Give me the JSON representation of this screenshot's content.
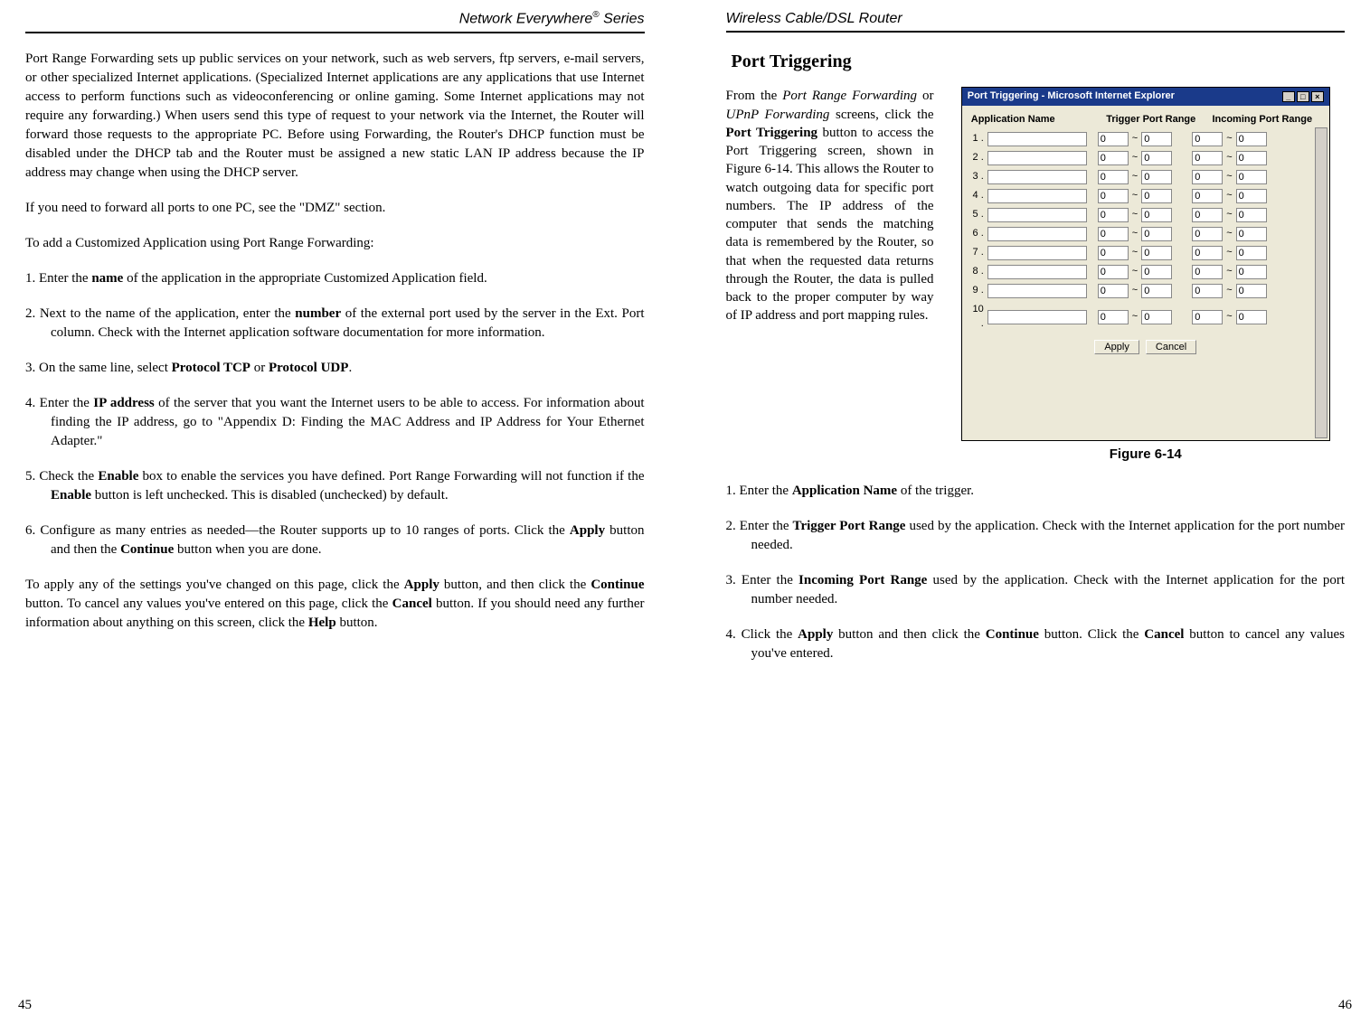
{
  "left": {
    "header": "Network Everywhere® Series",
    "pagenum": "45",
    "p1": "Port Range Forwarding sets up public services on your network, such as web servers, ftp servers, e-mail servers, or other specialized Internet applications. (Specialized Internet applications are any applications that use Internet access to perform functions such as videoconferencing or online gaming. Some Internet applications may not require any forwarding.) When users send this type of request to your network via the Internet, the Router will forward those requests to the appropriate PC.  Before using Forwarding, the Router's DHCP function must be disabled under the DHCP tab and the Router must be assigned a new static LAN IP address because the IP address may change when using the DHCP server.",
    "p2": "If you need to forward all ports to one PC, see the \"DMZ\" section.",
    "p3": "To add a Customized Application using Port Range Forwarding:",
    "s1a": "1.   Enter the ",
    "s1b": "name",
    "s1c": " of the application in the appropriate Customized Application field.",
    "s2a": "2.   Next to the name of the application, enter the ",
    "s2b": "number",
    "s2c": " of the external port used by the server in the Ext. Port column. Check with the Internet application software documentation for more information.",
    "s3a": "3.   On the same line, select ",
    "s3b": "Protocol TCP",
    "s3c": " or ",
    "s3d": "Protocol UDP",
    "s3e": ".",
    "s4a": "4.   Enter the ",
    "s4b": "IP address",
    "s4c": " of the server that you want the Internet users to be able to access. For information about finding the IP address, go to \"Appendix D: Finding the MAC Address and IP Address for Your Ethernet Adapter.\"",
    "s5a": "5.   Check the ",
    "s5b": "Enable",
    "s5c": " box to enable the services you have defined. Port Range Forwarding will not function if the ",
    "s5d": "Enable",
    "s5e": " button is left unchecked. This is disabled (unchecked) by default.",
    "s6a": "6.   Configure as many entries as needed—the Router supports up to 10 ranges of ports. Click the ",
    "s6b": "Apply",
    "s6c": " button and then the ",
    "s6d": "Continue",
    "s6e": " button when you are done.",
    "p4a": "To apply any of the settings you've changed on this page, click the ",
    "p4b": "Apply",
    "p4c": " button, and then click the ",
    "p4d": "Continue",
    "p4e": " button.  To cancel any values you've entered on this page, click the ",
    "p4f": "Cancel",
    "p4g": " button. If you should need any further information about anything on this screen, click the ",
    "p4h": "Help",
    "p4i": " button."
  },
  "right": {
    "header": "Wireless Cable/DSL Router",
    "pagenum": "46",
    "section": "Port Triggering",
    "intro_a": "From the ",
    "intro_b": "Port Range Forwarding",
    "intro_c": " or ",
    "intro_d": "UPnP Forwarding",
    "intro_e": " screens, click the ",
    "intro_f": "Port Triggering",
    "intro_g": " button to access the Port Triggering screen, shown in Figure 6-14. This allows the Router to watch outgoing data for specific port numbers.  The IP address of the computer that sends the matching data is remembered by the Router, so that when the requested data returns through the Router, the data is pulled back to the proper computer by way of IP address and port mapping rules.",
    "figcap": "Figure 6-14",
    "r1a": "1.   Enter the ",
    "r1b": "Application Name",
    "r1c": " of the trigger.",
    "r2a": "2.   Enter the ",
    "r2b": "Trigger Port Range",
    "r2c": " used by the application. Check with the Internet application for the port number needed.",
    "r3a": "3.   Enter the ",
    "r3b": "Incoming Port Range",
    "r3c": " used by the application. Check with the Internet application for the port number needed.",
    "r4a": "4.   Click the ",
    "r4b": "Apply",
    "r4c": " button and then click the ",
    "r4d": "Continue",
    "r4e": " button. Click the ",
    "r4f": "Cancel",
    "r4g": " button to cancel any values you've entered."
  },
  "win": {
    "title": "Port Triggering - Microsoft Internet Explorer",
    "col1": "Application Name",
    "col2": "Trigger Port Range",
    "col3": "Incoming Port Range",
    "rows": [
      "1",
      "2",
      "3",
      "4",
      "5",
      "6",
      "7",
      "8",
      "9",
      "10"
    ],
    "portdefault": "0",
    "apply": "Apply",
    "cancel": "Cancel"
  }
}
